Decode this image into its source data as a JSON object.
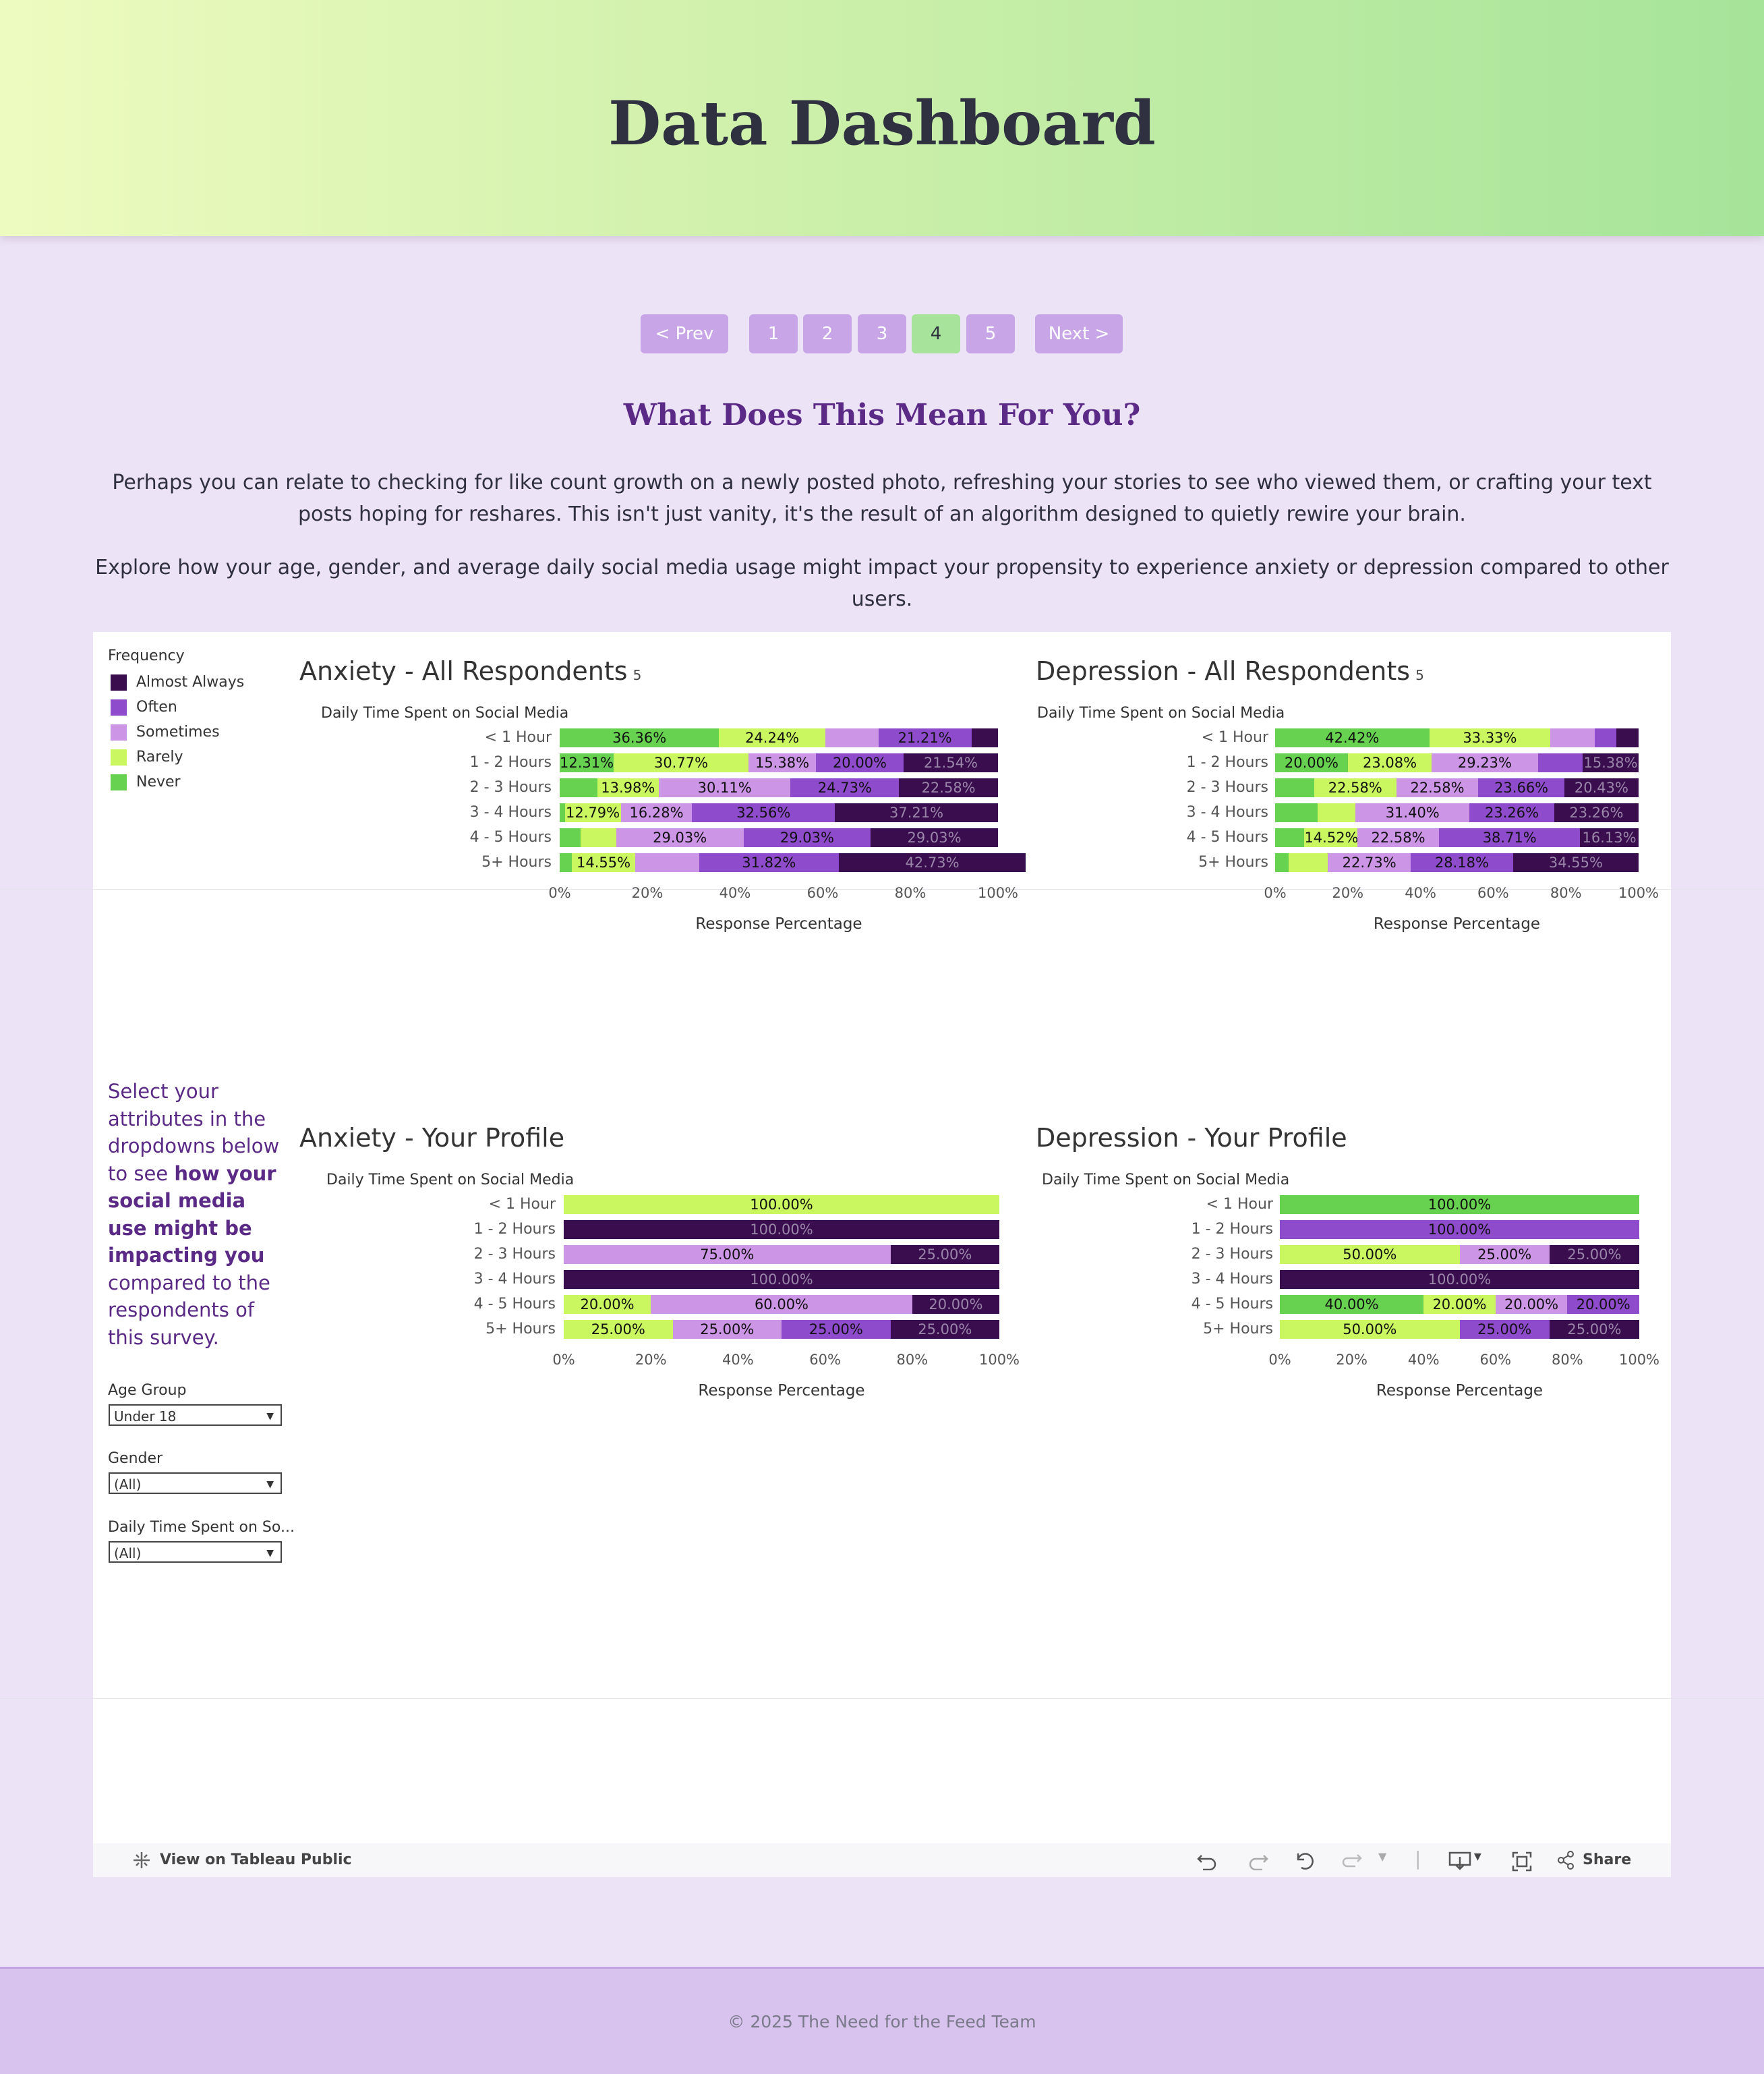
{
  "header": {
    "title": "Data Dashboard"
  },
  "pager": {
    "prev": "< Prev",
    "next": "Next >",
    "pages": [
      "1",
      "2",
      "3",
      "4",
      "5"
    ],
    "current": "4"
  },
  "intro": {
    "heading": "What Does This Mean For You?",
    "p1": "Perhaps you can relate to checking for like count growth on a newly posted photo, refreshing your stories to see who viewed them, or crafting your text posts hoping for reshares. This isn't just vanity, it's the result of an algorithm designed to quietly rewire your brain.",
    "p2": "Explore how your age, gender, and average daily social media usage might impact your propensity to experience anxiety or depression compared to other users."
  },
  "legend": {
    "title": "Frequency",
    "items": [
      {
        "label": "Almost Always",
        "color": "#3a0d4f"
      },
      {
        "label": "Often",
        "color": "#8e4bcc"
      },
      {
        "label": "Sometimes",
        "color": "#cc95e6"
      },
      {
        "label": "Rarely",
        "color": "#caf760"
      },
      {
        "label": "Never",
        "color": "#66d24f"
      }
    ]
  },
  "sidebar": {
    "prompt_pre": "Select your attributes in the dropdowns below to see ",
    "prompt_bold": "how your social media use might be impacting you",
    "prompt_post": " compared to the respondents of this survey.",
    "filters": [
      {
        "label": "Age Group",
        "value": "Under 18"
      },
      {
        "label": "Gender",
        "value": "(All)"
      },
      {
        "label": "Daily Time Spent on So...",
        "value": "(All)"
      }
    ]
  },
  "toolbar": {
    "view_public": "View on Tableau Public",
    "share": "Share"
  },
  "footer": {
    "text": "© 2025 The Need for the Feed Team"
  },
  "chart_data": [
    {
      "type": "bar",
      "stacked": "100%",
      "orientation": "horizontal",
      "title": "Anxiety - All Respondents",
      "title_note": "5",
      "row_header": "Daily Time Spent on Social Media",
      "xlabel": "Response Percentage",
      "xlim": [
        0,
        100
      ],
      "ticks": [
        "0%",
        "20%",
        "40%",
        "60%",
        "80%",
        "100%"
      ],
      "categories": [
        "< 1 Hour",
        "1 - 2 Hours",
        "2 - 3 Hours",
        "3 - 4 Hours",
        "4 - 5 Hours",
        "5+ Hours"
      ],
      "series": [
        {
          "name": "Never",
          "values": [
            36.36,
            12.31,
            8.6,
            1.16,
            4.84,
            2.73
          ]
        },
        {
          "name": "Rarely",
          "values": [
            24.24,
            30.77,
            13.98,
            12.79,
            8.06,
            14.55
          ]
        },
        {
          "name": "Sometimes",
          "values": [
            12.12,
            15.38,
            30.11,
            16.28,
            29.03,
            14.55
          ]
        },
        {
          "name": "Often",
          "values": [
            21.21,
            20.0,
            24.73,
            32.56,
            29.03,
            31.82
          ]
        },
        {
          "name": "Almost Always",
          "values": [
            6.07,
            21.54,
            22.58,
            37.21,
            29.03,
            42.73
          ]
        }
      ],
      "labels": [
        [
          "36.36%",
          "24.24%",
          "",
          "21.21%",
          ""
        ],
        [
          "12.31%",
          "30.77%",
          "15.38%",
          "20.00%",
          "21.54%"
        ],
        [
          "",
          "13.98%",
          "30.11%",
          "24.73%",
          "22.58%"
        ],
        [
          "",
          "12.79%",
          "16.28%",
          "32.56%",
          "37.21%"
        ],
        [
          "",
          "",
          "29.03%",
          "29.03%",
          "29.03%"
        ],
        [
          "",
          "14.55%",
          "",
          "31.82%",
          "42.73%"
        ]
      ]
    },
    {
      "type": "bar",
      "stacked": "100%",
      "orientation": "horizontal",
      "title": "Depression - All Respondents",
      "title_note": "5",
      "row_header": "Daily Time Spent on Social Media",
      "xlabel": "Response Percentage",
      "xlim": [
        0,
        100
      ],
      "ticks": [
        "0%",
        "20%",
        "40%",
        "60%",
        "80%",
        "100%"
      ],
      "categories": [
        "< 1 Hour",
        "1 - 2 Hours",
        "2 - 3 Hours",
        "3 - 4 Hours",
        "4 - 5 Hours",
        "5+ Hours"
      ],
      "series": [
        {
          "name": "Never",
          "values": [
            42.42,
            20.0,
            10.75,
            11.63,
            8.06,
            3.64
          ]
        },
        {
          "name": "Rarely",
          "values": [
            33.33,
            23.08,
            22.58,
            10.47,
            14.52,
            10.91
          ]
        },
        {
          "name": "Sometimes",
          "values": [
            12.12,
            29.23,
            22.58,
            31.4,
            22.58,
            22.73
          ]
        },
        {
          "name": "Often",
          "values": [
            6.07,
            12.31,
            23.66,
            23.26,
            38.71,
            28.18
          ]
        },
        {
          "name": "Almost Always",
          "values": [
            6.06,
            15.38,
            20.43,
            23.26,
            16.13,
            34.55
          ]
        }
      ],
      "labels": [
        [
          "42.42%",
          "33.33%",
          "",
          "",
          ""
        ],
        [
          "20.00%",
          "23.08%",
          "29.23%",
          "",
          "15.38%"
        ],
        [
          "",
          "22.58%",
          "22.58%",
          "23.66%",
          "20.43%"
        ],
        [
          "",
          "",
          "31.40%",
          "23.26%",
          "23.26%"
        ],
        [
          "",
          "14.52%",
          "22.58%",
          "38.71%",
          "16.13%"
        ],
        [
          "",
          "",
          "22.73%",
          "28.18%",
          "34.55%"
        ]
      ]
    },
    {
      "type": "bar",
      "stacked": "100%",
      "orientation": "horizontal",
      "title": "Anxiety - Your Profile",
      "row_header": "Daily Time Spent on Social Media",
      "xlabel": "Response Percentage",
      "xlim": [
        0,
        100
      ],
      "ticks": [
        "0%",
        "20%",
        "40%",
        "60%",
        "80%",
        "100%"
      ],
      "categories": [
        "< 1 Hour",
        "1 - 2 Hours",
        "2 - 3 Hours",
        "3 - 4 Hours",
        "4 - 5 Hours",
        "5+ Hours"
      ],
      "series": [
        {
          "name": "Never",
          "values": [
            0,
            0,
            0,
            0,
            0,
            0
          ]
        },
        {
          "name": "Rarely",
          "values": [
            100,
            0,
            0,
            0,
            20,
            25
          ]
        },
        {
          "name": "Sometimes",
          "values": [
            0,
            0,
            75,
            0,
            60,
            25
          ]
        },
        {
          "name": "Often",
          "values": [
            0,
            0,
            0,
            0,
            0,
            25
          ]
        },
        {
          "name": "Almost Always",
          "values": [
            0,
            100,
            25,
            100,
            20,
            25
          ]
        }
      ],
      "labels": [
        [
          "",
          "100.00%",
          "",
          "",
          ""
        ],
        [
          "",
          "",
          "",
          "",
          "100.00%"
        ],
        [
          "",
          "",
          "75.00%",
          "",
          "25.00%"
        ],
        [
          "",
          "",
          "",
          "",
          "100.00%"
        ],
        [
          "",
          "20.00%",
          "60.00%",
          "",
          "20.00%"
        ],
        [
          "",
          "25.00%",
          "25.00%",
          "25.00%",
          "25.00%"
        ]
      ]
    },
    {
      "type": "bar",
      "stacked": "100%",
      "orientation": "horizontal",
      "title": "Depression - Your Profile",
      "row_header": "Daily Time Spent on Social Media",
      "xlabel": "Response Percentage",
      "xlim": [
        0,
        100
      ],
      "ticks": [
        "0%",
        "20%",
        "40%",
        "60%",
        "80%",
        "100%"
      ],
      "categories": [
        "< 1 Hour",
        "1 - 2 Hours",
        "2 - 3 Hours",
        "3 - 4 Hours",
        "4 - 5 Hours",
        "5+ Hours"
      ],
      "series": [
        {
          "name": "Never",
          "values": [
            100,
            0,
            0,
            0,
            40,
            0
          ]
        },
        {
          "name": "Rarely",
          "values": [
            0,
            0,
            50,
            0,
            20,
            50
          ]
        },
        {
          "name": "Sometimes",
          "values": [
            0,
            0,
            25,
            0,
            20,
            0
          ]
        },
        {
          "name": "Often",
          "values": [
            0,
            100,
            0,
            0,
            20,
            25
          ]
        },
        {
          "name": "Almost Always",
          "values": [
            0,
            0,
            25,
            100,
            0,
            25
          ]
        }
      ],
      "labels": [
        [
          "100.00%",
          "",
          "",
          "",
          ""
        ],
        [
          "",
          "",
          "",
          "100.00%",
          ""
        ],
        [
          "",
          "50.00%",
          "25.00%",
          "",
          "25.00%"
        ],
        [
          "",
          "",
          "",
          "",
          "100.00%"
        ],
        [
          "40.00%",
          "20.00%",
          "20.00%",
          "20.00%",
          ""
        ],
        [
          "",
          "50.00%",
          "",
          "25.00%",
          "25.00%"
        ]
      ]
    }
  ]
}
